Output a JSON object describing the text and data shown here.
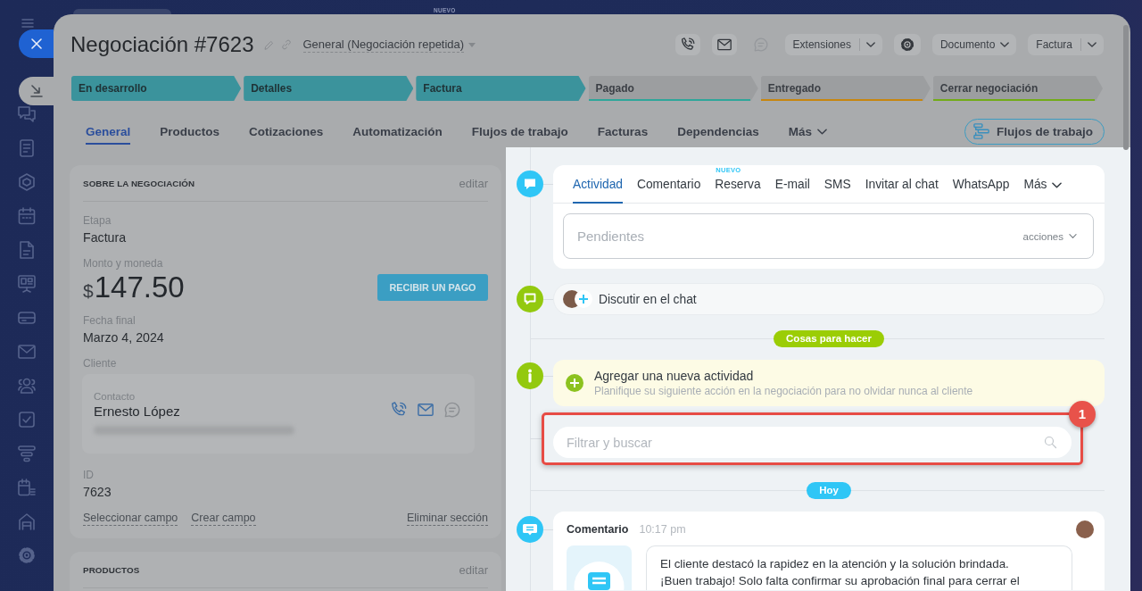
{
  "top_bar": {
    "badge": "NUEVO"
  },
  "header": {
    "title": "Negociación #7623",
    "pipeline": "General (Negociación repetida)"
  },
  "toolbar": [
    {
      "kind": "icon",
      "disabled": false
    },
    {
      "kind": "icon",
      "disabled": false
    },
    {
      "kind": "icon",
      "disabled": true
    },
    {
      "kind": "split",
      "label": "Extensiones"
    },
    {
      "kind": "icon",
      "disabled": false
    },
    {
      "kind": "dropdown",
      "label": "Documento"
    },
    {
      "kind": "split",
      "label": "Factura"
    }
  ],
  "stages": [
    {
      "label": "En desarrollo",
      "color": "#3b939c",
      "reached": true
    },
    {
      "label": "Detalles",
      "color": "#3b939c",
      "reached": true
    },
    {
      "label": "Factura",
      "color": "#3b939c",
      "reached": true
    },
    {
      "label": "Pagado",
      "color": "#2fa69a",
      "reached": false
    },
    {
      "label": "Entregado",
      "color": "#c7860f",
      "reached": false
    },
    {
      "label": "Cerrar negociación",
      "color": "#72ab18",
      "reached": false
    }
  ],
  "tabs": [
    {
      "kind": "tab",
      "label": "General",
      "selected": true
    },
    {
      "kind": "tab",
      "label": "Productos",
      "selected": false
    },
    {
      "kind": "tab",
      "label": "Cotizaciones",
      "selected": false
    },
    {
      "kind": "tab",
      "label": "Automatización",
      "selected": false
    },
    {
      "kind": "tab",
      "label": "Flujos de trabajo",
      "selected": false
    },
    {
      "kind": "tab",
      "label": "Facturas",
      "selected": false
    },
    {
      "kind": "tab",
      "label": "Dependencias",
      "selected": false
    },
    {
      "kind": "menu",
      "label": "Más",
      "selected": false
    }
  ],
  "workflow_button": {
    "label": "Flujos de trabajo"
  },
  "about_card": {
    "title": "SOBRE LA NEGOCIACIÓN",
    "edit": "editar",
    "fields": [
      {
        "kind": "text",
        "label": "Etapa",
        "value": "Factura"
      },
      {
        "kind": "amount",
        "label": "Monto y moneda",
        "currency": "$",
        "value": "147.50",
        "action": "RECIBIR UN PAGO"
      },
      {
        "kind": "text",
        "label": "Fecha final",
        "value": "Marzo 4, 2024"
      },
      {
        "kind": "client",
        "label": "Cliente",
        "contact_label": "Contacto",
        "name": "Ernesto López",
        "actions": [
          {
            "disabled": false
          },
          {
            "disabled": false
          },
          {
            "disabled": true
          }
        ]
      },
      {
        "kind": "text",
        "label": "ID",
        "value": "7623"
      }
    ],
    "links": [
      "Seleccionar campo",
      "Crear campo"
    ],
    "delete_link": "Eliminar sección"
  },
  "products_card": {
    "title": "PRODUCTOS",
    "edit": "editar"
  },
  "timeline": {
    "composer": {
      "tabs": [
        {
          "kind": "tab",
          "label": "Actividad",
          "selected": true
        },
        {
          "kind": "tab",
          "label": "Comentario",
          "selected": false
        },
        {
          "kind": "tab",
          "label": "Reserva",
          "selected": false,
          "badge": "NUEVO"
        },
        {
          "kind": "tab",
          "label": "E-mail",
          "selected": false
        },
        {
          "kind": "tab",
          "label": "SMS",
          "selected": false
        },
        {
          "kind": "tab",
          "label": "Invitar al chat",
          "selected": false
        },
        {
          "kind": "tab",
          "label": "WhatsApp",
          "selected": false
        },
        {
          "kind": "menu",
          "label": "Más",
          "selected": false
        }
      ],
      "placeholder": "Pendientes",
      "actions": "acciones"
    },
    "chat": {
      "label": "Discutir en el chat"
    },
    "todo_label": "Cosas para hacer",
    "new_activity": {
      "title": "Agregar una nueva actividad",
      "hint": "Planifique su siguiente acción en la negociación para no olvidar nunca al cliente"
    },
    "search": {
      "placeholder": "Filtrar y buscar"
    },
    "annotation": {
      "number": "1"
    },
    "date_label": "Hoy",
    "entries": [
      {
        "type": "Comentario",
        "time": "10:17 pm",
        "text": "El cliente destacó la rapidez en la atención y la solución brindada.\n¡Buen trabajo! Solo falta confirmar su aprobación final para cerrar el"
      }
    ]
  }
}
